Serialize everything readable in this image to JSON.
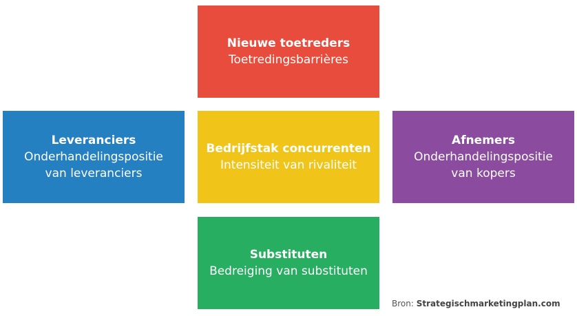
{
  "boxes": {
    "top": {
      "title": "Nieuwe toetreders",
      "subtitle": "Toetredingsbarrières",
      "color": "#E84C3D"
    },
    "left": {
      "title": "Leveranciers",
      "subtitle_line1": "Onderhandelingspositie",
      "subtitle_line2": "van leveranciers",
      "color": "#2580C2"
    },
    "center": {
      "title": "Bedrijfstak concurrenten",
      "subtitle": "Intensiteit van rivaliteit",
      "color": "#F0C419"
    },
    "right": {
      "title": "Afnemers",
      "subtitle_line1": "Onderhandelingspositie",
      "subtitle_line2": "van kopers",
      "color": "#8B4B9E"
    },
    "bottom": {
      "title": "Substituten",
      "subtitle": "Bedreiging van substituten",
      "color": "#27AE60"
    }
  },
  "source": {
    "label": "Bron:",
    "site": "Strategischmarketingplan.com"
  }
}
